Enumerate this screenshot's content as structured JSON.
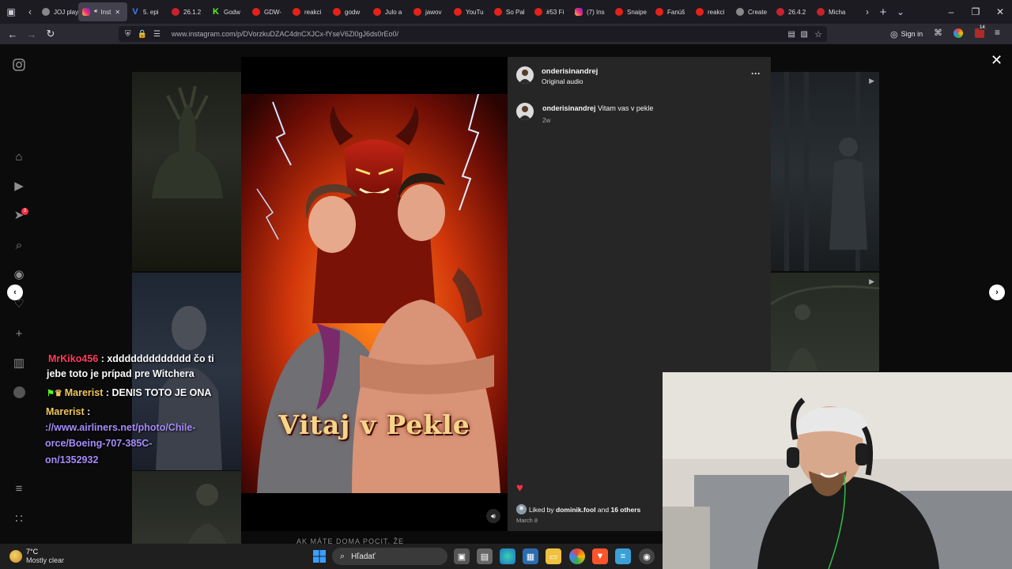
{
  "browser": {
    "tabs": [
      {
        "label": "JOJ play",
        "icon": "joj"
      },
      {
        "label": "Inst",
        "icon": "instagram",
        "active": true
      },
      {
        "label": "5. epi",
        "icon": "v"
      },
      {
        "label": "26.1.2",
        "icon": "pin"
      },
      {
        "label": "Godw",
        "icon": "k"
      },
      {
        "label": "GDW-",
        "icon": "yt"
      },
      {
        "label": "reakci",
        "icon": "yt"
      },
      {
        "label": "godw",
        "icon": "yt"
      },
      {
        "label": "Julo a",
        "icon": "yt"
      },
      {
        "label": "jawov",
        "icon": "yt"
      },
      {
        "label": "YouTu",
        "icon": "yt"
      },
      {
        "label": "So Pal",
        "icon": "yt"
      },
      {
        "label": "#53 Fi",
        "icon": "yt"
      },
      {
        "label": "(7) Ins",
        "icon": "instagram"
      },
      {
        "label": "Snaipe",
        "icon": "yt"
      },
      {
        "label": "Fanúš",
        "icon": "yt"
      },
      {
        "label": "reakci",
        "icon": "yt"
      },
      {
        "label": "Create",
        "icon": "generic"
      },
      {
        "label": "26.4.2",
        "icon": "pin"
      },
      {
        "label": "Micha",
        "icon": "pin"
      }
    ],
    "url": "www.instagram.com/p/DVorzkuDZAC4dnCXJCx-fYseV6Zl0gJ6ds0rEo0/",
    "sign_in": "Sign in",
    "notification_badge": "14"
  },
  "post": {
    "username": "onderisinandrej",
    "audio": "Original audio",
    "caption_user": "onderisinandrej",
    "caption_text": "Vitam vas v pekle",
    "caption_age": "2w",
    "liked_prefix": "Liked by ",
    "liked_user": "dominik.fool",
    "liked_mid": " and ",
    "liked_others": "16 others",
    "date": "March 8",
    "poster_title": "Vitaj v Pekle",
    "more": "···"
  },
  "sidebar": {
    "notification_count": "3"
  },
  "background_text": {
    "bottom_caption": "AK MÁTE DOMA POCIT, ŽE"
  },
  "chat": [
    {
      "user": "MrKiko456",
      "sep": " : ",
      "text": "xddddddddddddd čo ti",
      "color": "#ff3b5c"
    },
    {
      "text": "jebe toto je prípad pre Witchera"
    },
    {
      "user": "Marerist",
      "sep": " : ",
      "text": "DENIS TOTO JE ONA",
      "color": "#f0c65a"
    },
    {
      "user": "Marerist",
      "sep": " :",
      "color": "#f0c65a"
    },
    {
      "link": "://www.airliners.net/photo/Chile-"
    },
    {
      "link": "orce/Boeing-707-385C-"
    },
    {
      "link": "on/1352932"
    }
  ],
  "taskbar": {
    "temp": "7°C",
    "weather": "Mostly clear",
    "search_placeholder": "Hľadať"
  }
}
